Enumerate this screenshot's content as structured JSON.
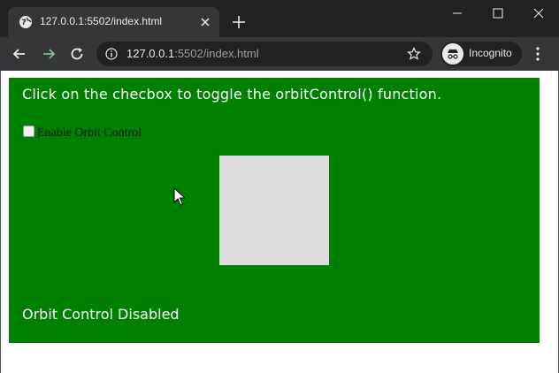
{
  "browser": {
    "tab_title": "127.0.0.1:5502/index.html",
    "url_host": "127.0.0.1",
    "url_path": ":5502/index.html",
    "incognito_label": "Incognito",
    "icons": {
      "favicon": "globe-icon",
      "tab_close": "close-icon",
      "new_tab": "plus-icon",
      "back": "arrow-left-icon",
      "forward": "arrow-right-icon",
      "reload": "reload-icon",
      "site_info": "info-icon",
      "bookmark": "star-icon",
      "incognito": "incognito-icon",
      "menu": "kebab-menu-icon",
      "minimize": "minimize-icon",
      "maximize": "maximize-icon",
      "close": "close-icon"
    }
  },
  "page": {
    "instruction": "Click on the checbox to toggle the orbitControl() function.",
    "checkbox_label": "Enable Orbit Control",
    "checkbox_checked": false,
    "status": "Orbit Control Disabled",
    "colors": {
      "canvas_background": "#008000",
      "box": "#dcdcdc",
      "text": "#ffffff"
    }
  }
}
